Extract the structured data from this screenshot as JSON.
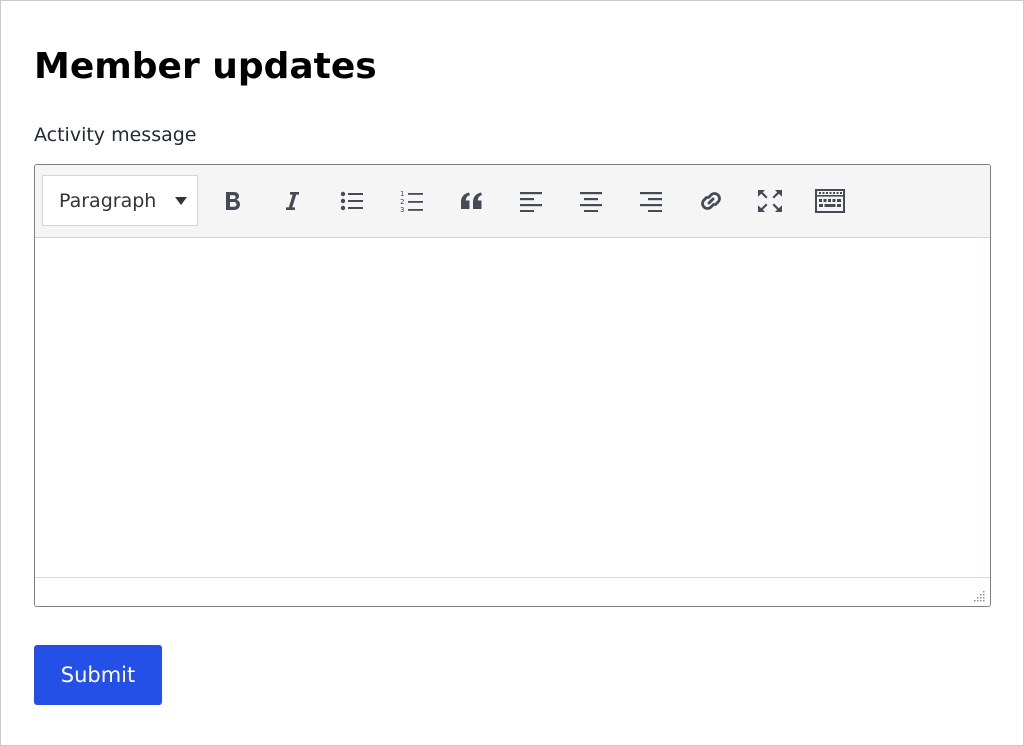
{
  "page": {
    "title": "Member updates"
  },
  "form": {
    "field_label": "Activity message",
    "submit_label": "Submit"
  },
  "editor": {
    "format_select": {
      "selected": "Paragraph"
    },
    "toolbar_icons": [
      "bold-icon",
      "italic-icon",
      "bulleted-list-icon",
      "numbered-list-icon",
      "blockquote-icon",
      "align-left-icon",
      "align-center-icon",
      "align-right-icon",
      "link-icon",
      "fullscreen-icon",
      "source-keyboard-icon"
    ],
    "content": ""
  },
  "colors": {
    "accent": "#2550e8",
    "toolbar_bg": "#f4f5f4",
    "icon": "#444b55",
    "border": "#7c7f86"
  }
}
